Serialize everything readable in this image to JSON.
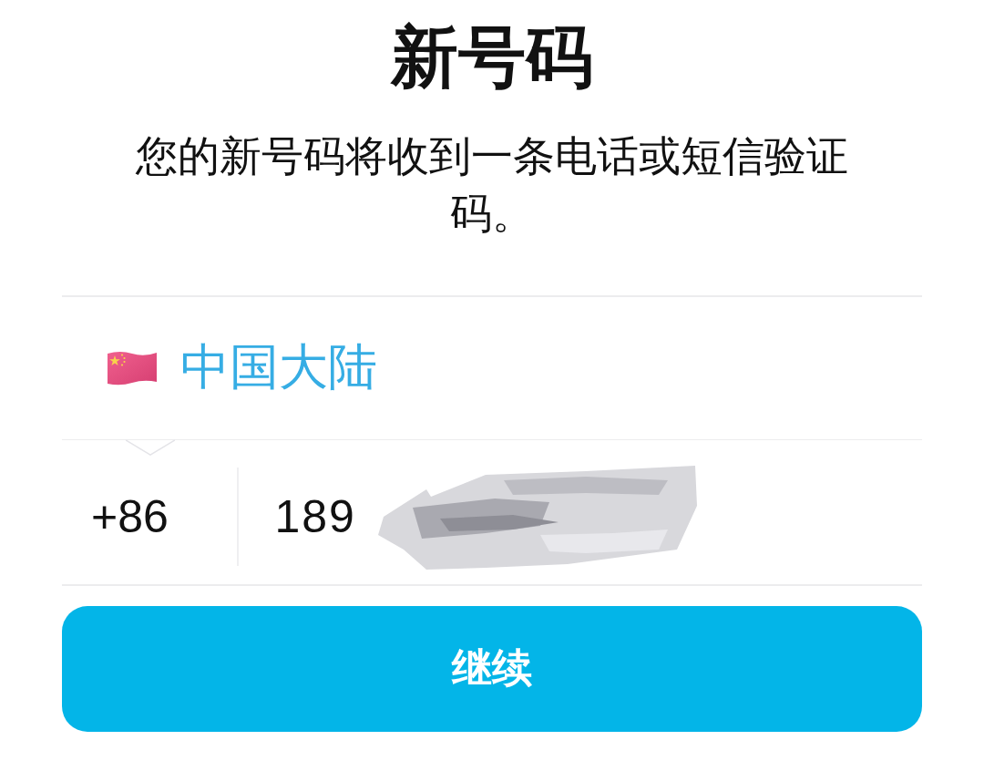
{
  "title": "新号码",
  "subtitle": "您的新号码将收到一条电话或短信验证码。",
  "country": {
    "name": "中国大陆"
  },
  "phone": {
    "country_code": "+86",
    "number": "189",
    "redacted": true
  },
  "continue_button": {
    "label": "继续"
  }
}
